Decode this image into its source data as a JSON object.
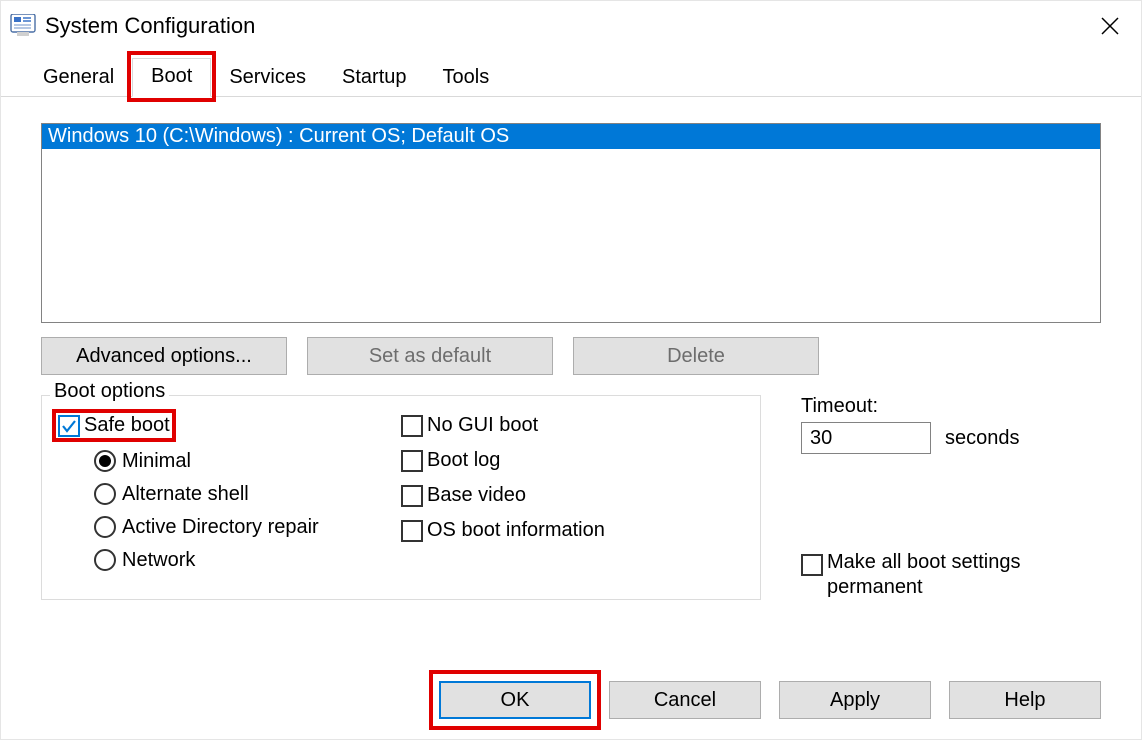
{
  "window": {
    "title": "System Configuration"
  },
  "tabs": {
    "general": "General",
    "boot": "Boot",
    "services": "Services",
    "startup": "Startup",
    "tools": "Tools",
    "active": "boot"
  },
  "boot_list": {
    "items": [
      "Windows 10 (C:\\Windows) : Current OS; Default OS"
    ]
  },
  "buttons": {
    "advanced": "Advanced options...",
    "set_default": "Set as default",
    "delete": "Delete"
  },
  "boot_options": {
    "group_label": "Boot options",
    "safe_boot": {
      "label": "Safe boot",
      "checked": true
    },
    "radios": {
      "minimal": "Minimal",
      "alternate_shell": "Alternate shell",
      "ad_repair": "Active Directory repair",
      "network": "Network",
      "selected": "minimal"
    },
    "no_gui": {
      "label": "No GUI boot",
      "checked": false
    },
    "boot_log": {
      "label": "Boot log",
      "checked": false
    },
    "base_video": {
      "label": "Base video",
      "checked": false
    },
    "os_boot_info": {
      "label": "OS boot information",
      "checked": false
    }
  },
  "timeout": {
    "label": "Timeout:",
    "value": "30",
    "unit": "seconds"
  },
  "make_permanent": {
    "label": "Make all boot settings permanent",
    "checked": false
  },
  "dialog_buttons": {
    "ok": "OK",
    "cancel": "Cancel",
    "apply": "Apply",
    "help": "Help"
  }
}
